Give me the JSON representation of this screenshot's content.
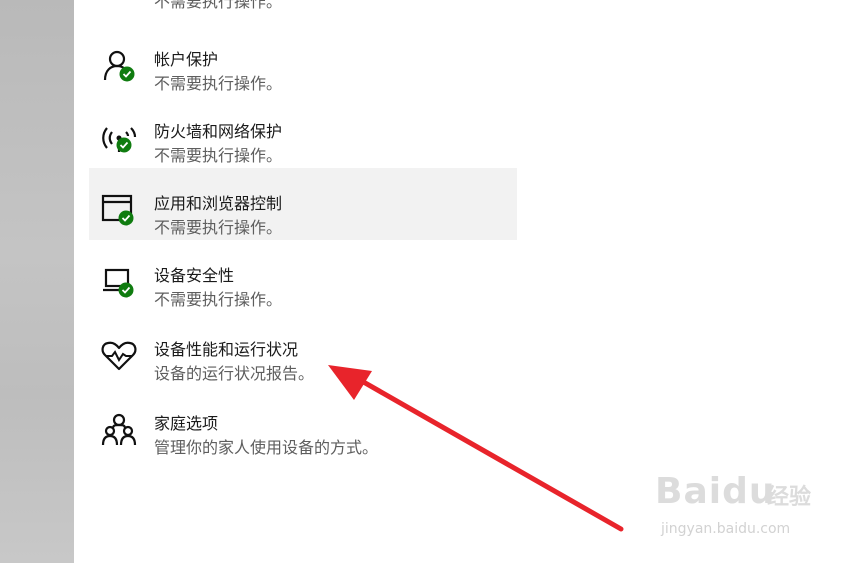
{
  "top_partial_subtitle": "不需要执行操作。",
  "items": [
    {
      "title": "帐户保护",
      "subtitle": "不需要执行操作。",
      "icon": "account-protection-icon"
    },
    {
      "title": "防火墙和网络保护",
      "subtitle": "不需要执行操作。",
      "icon": "firewall-network-icon"
    },
    {
      "title": "应用和浏览器控制",
      "subtitle": "不需要执行操作。",
      "icon": "app-browser-control-icon"
    },
    {
      "title": "设备安全性",
      "subtitle": "不需要执行操作。",
      "icon": "device-security-icon"
    },
    {
      "title": "设备性能和运行状况",
      "subtitle": "设备的运行状况报告。",
      "icon": "device-health-icon"
    },
    {
      "title": "家庭选项",
      "subtitle": "管理你的家人使用设备的方式。",
      "icon": "family-options-icon"
    }
  ],
  "selected_index": 2,
  "colors": {
    "check_badge": "#107c10",
    "arrow": "#e8242b",
    "selected_bg": "#f2f2f2"
  },
  "watermark": {
    "main": "Baidu",
    "suffix": "经验",
    "url": "jingyan.baidu.com"
  }
}
